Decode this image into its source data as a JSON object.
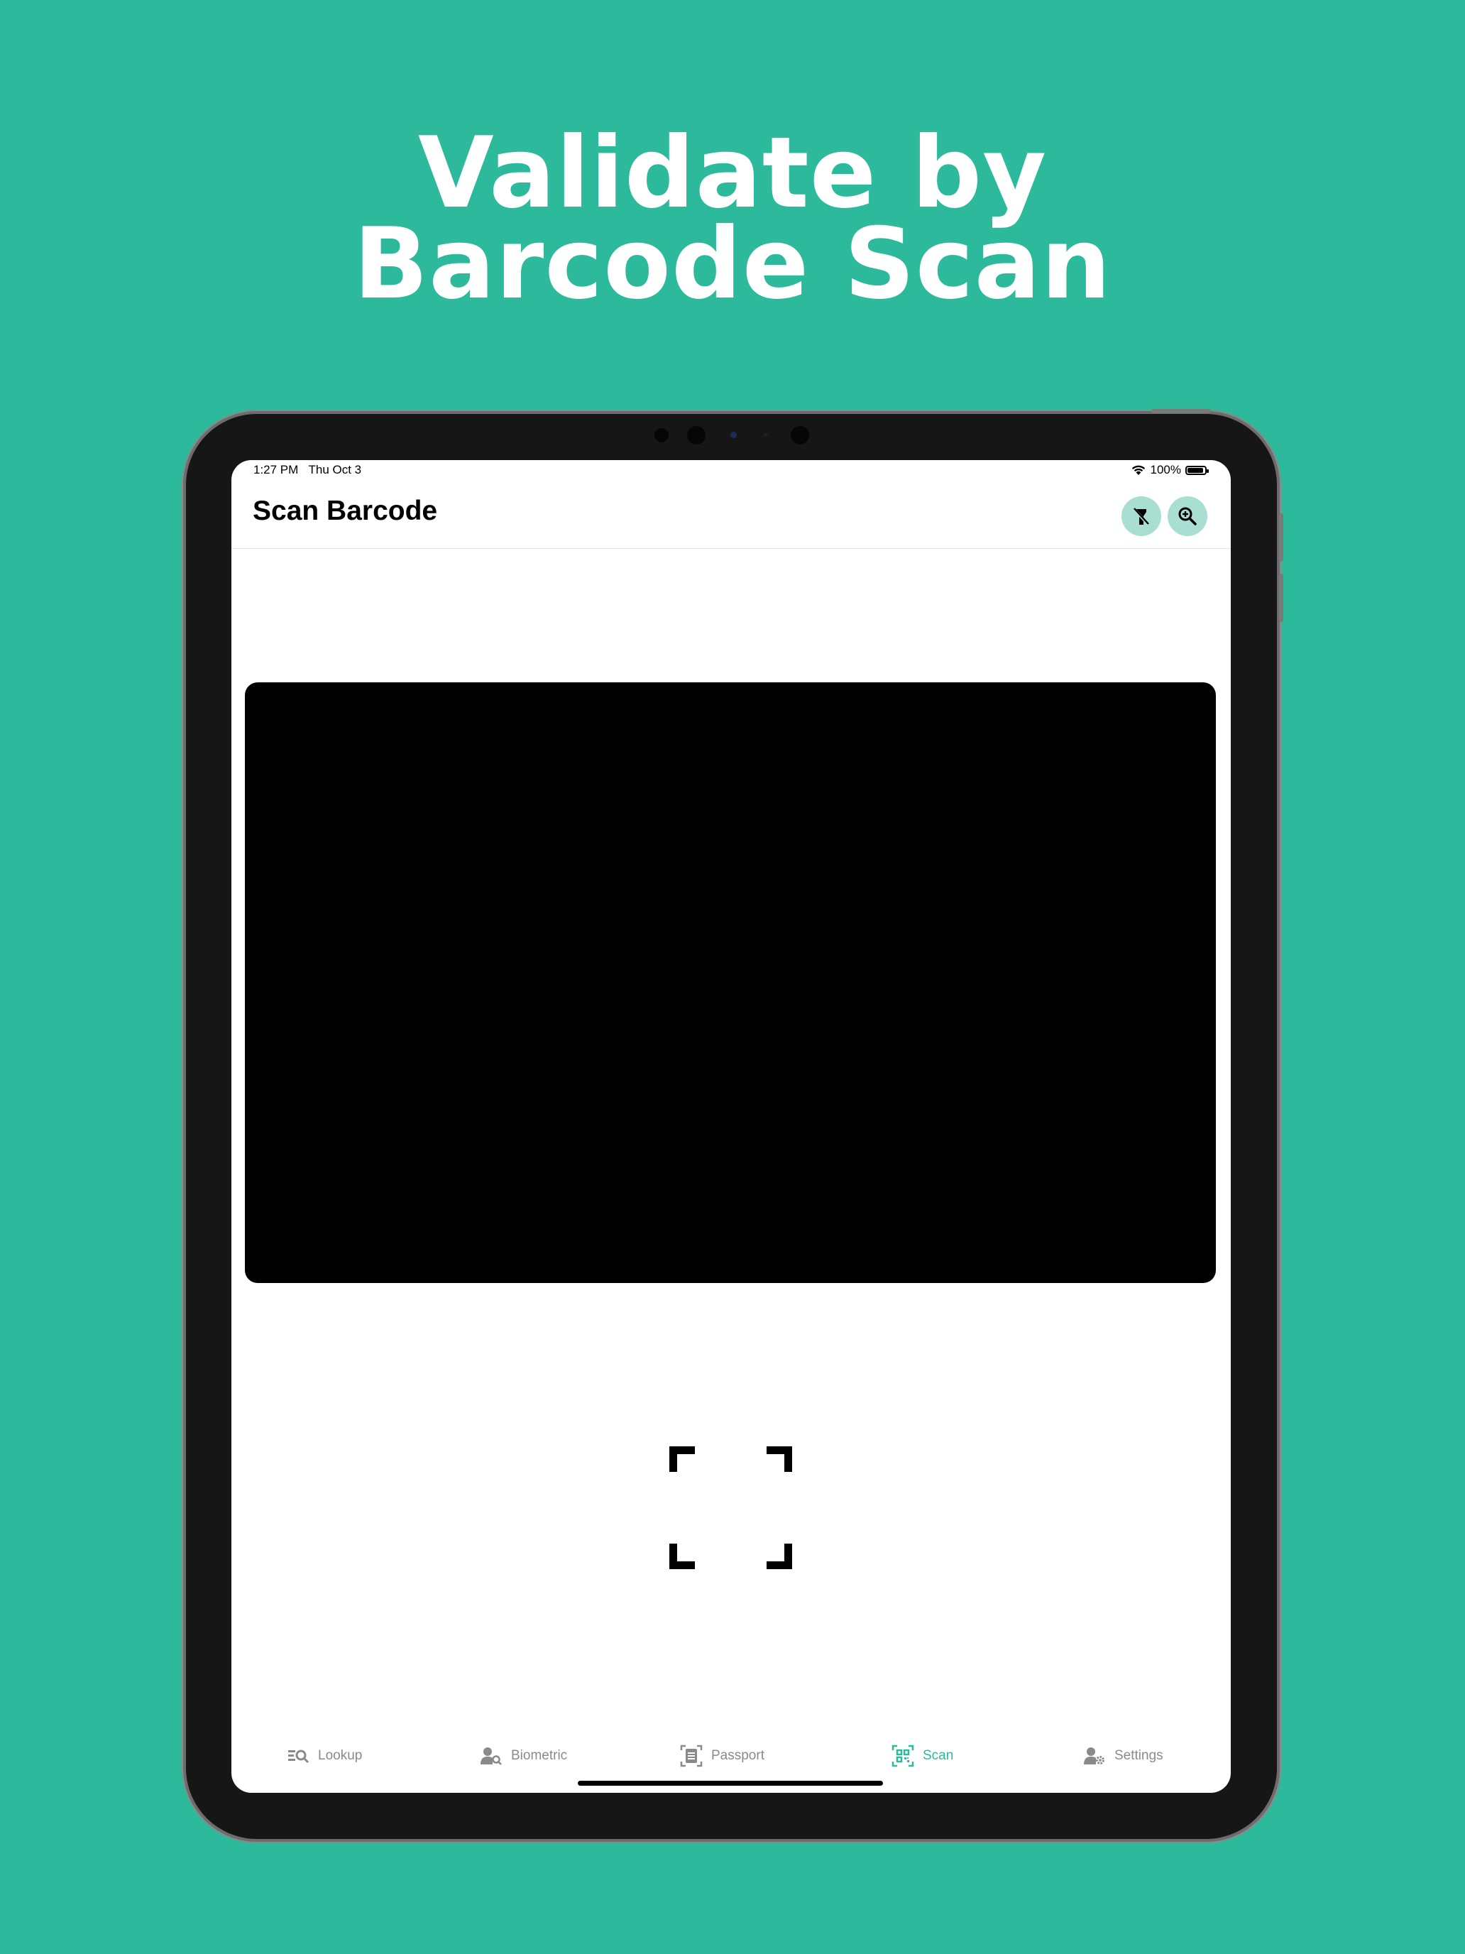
{
  "promo": {
    "headline_line1": "Validate by",
    "headline_line2": "Barcode Scan"
  },
  "colors": {
    "background": "#2db99b",
    "accent": "#2db99b",
    "button_bg": "#a9dfd3"
  },
  "status_bar": {
    "time": "1:27 PM",
    "date": "Thu Oct 3",
    "battery": "100%",
    "battery_level": 1.0
  },
  "nav": {
    "title": "Scan Barcode",
    "flashlight_icon": "flashlight-off-icon",
    "zoom_icon": "zoom-in-icon"
  },
  "tabs": [
    {
      "label": "Lookup",
      "icon": "list-search-icon",
      "active": false
    },
    {
      "label": "Biometric",
      "icon": "person-search-icon",
      "active": false
    },
    {
      "label": "Passport",
      "icon": "document-scan-icon",
      "active": false
    },
    {
      "label": "Scan",
      "icon": "qr-scan-icon",
      "active": true
    },
    {
      "label": "Settings",
      "icon": "person-gear-icon",
      "active": false
    }
  ]
}
